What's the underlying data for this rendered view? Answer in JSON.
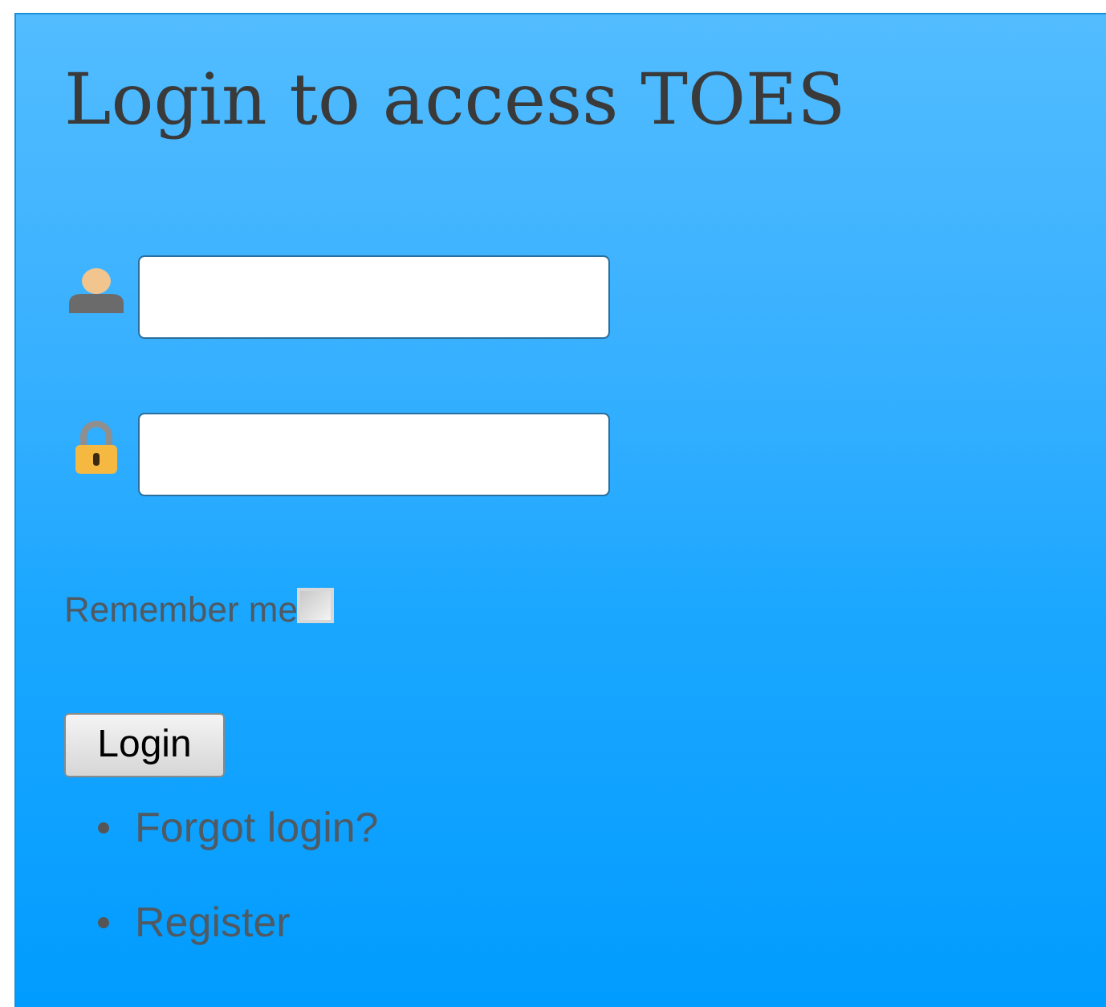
{
  "title": "Login to access TOES",
  "fields": [
    {
      "kind": "username"
    },
    {
      "kind": "password"
    }
  ],
  "remember": {
    "label": "Remember me",
    "checked": false
  },
  "button": "Login",
  "links": [
    "Forgot login?",
    "Register"
  ]
}
